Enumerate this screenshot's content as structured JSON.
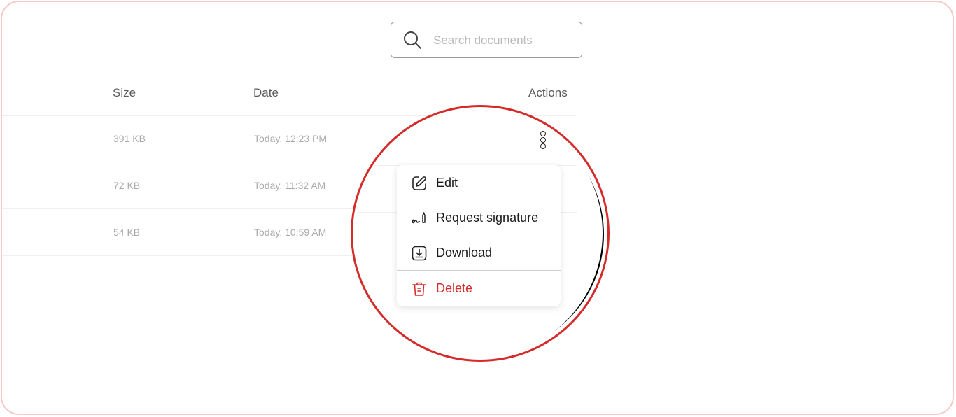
{
  "search": {
    "placeholder": "Search documents",
    "icon": "search-icon"
  },
  "table": {
    "columns": {
      "size": "Size",
      "date": "Date",
      "actions": "Actions"
    },
    "rows": [
      {
        "size": "391 KB",
        "date": "Today, 12:23 PM"
      },
      {
        "size": "72 KB",
        "date": "Today, 11:32 AM"
      },
      {
        "size": "54 KB",
        "date": "Today, 10:59 AM"
      }
    ]
  },
  "actions_menu": {
    "items": [
      {
        "label": "Edit",
        "icon": "edit-icon"
      },
      {
        "label": "Request signature",
        "icon": "signature-icon"
      },
      {
        "label": "Download",
        "icon": "download-icon"
      },
      {
        "label": "Delete",
        "icon": "trash-icon"
      }
    ]
  },
  "colors": {
    "accent_red": "#d52b2b",
    "frame_border": "#f6c9c9",
    "muted_text": "#aaaaaa"
  }
}
